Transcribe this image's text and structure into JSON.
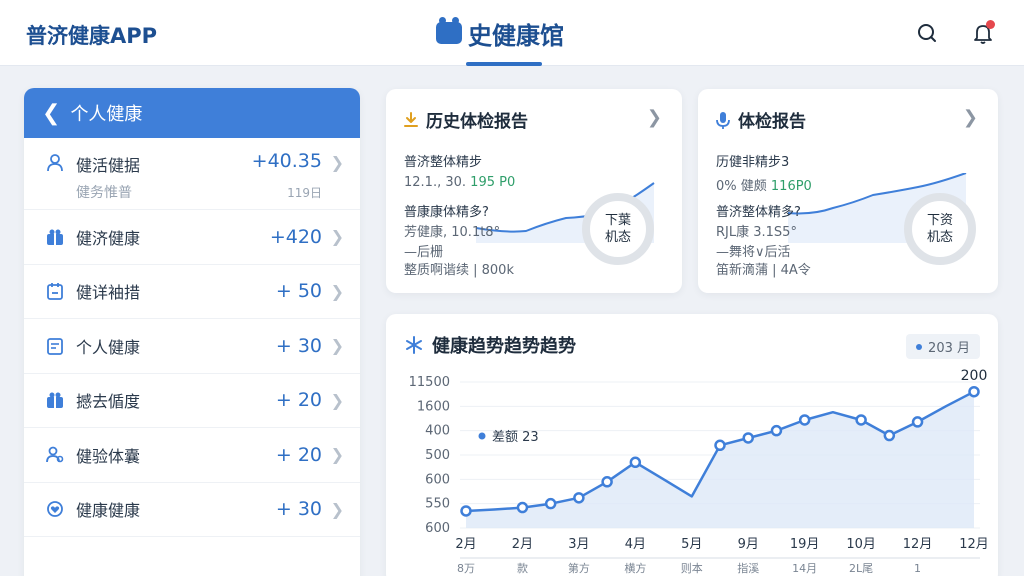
{
  "header": {
    "brand": "普济健康APP",
    "title": "史健康馆",
    "title_icon": "badge-icon"
  },
  "sidebar": {
    "title": "个人健康",
    "items": [
      {
        "label": "健活健据",
        "sub": "健务惟普",
        "sub_right": "119日",
        "value": "+40.35",
        "icon": "user-icon"
      },
      {
        "label": "健济健康",
        "value": "+420",
        "icon": "gift-icon"
      },
      {
        "label": "健详袖措",
        "value": "+ 50",
        "icon": "calendar-icon"
      },
      {
        "label": "个人健康",
        "value": "+ 30",
        "icon": "document-icon"
      },
      {
        "label": "撼去偱度",
        "value": "+ 20",
        "icon": "gift-icon"
      },
      {
        "label": "健验体囊",
        "value": "+ 20",
        "icon": "people-icon"
      },
      {
        "label": "健康健康",
        "value": "+ 30",
        "icon": "heart-icon"
      }
    ]
  },
  "card_history": {
    "title": "历史体检报告",
    "line1": "普济整体精步",
    "line2_a": "12.1., 30.",
    "line2_b": "195 P0",
    "line3": "普康康体精多?",
    "line4": "芳健康, 10.1t8°",
    "line5": "—后栅",
    "line6": "整质啊谐续 | 800k",
    "ring_top": "下葉",
    "ring_bottom": "机态"
  },
  "card_report": {
    "title": "体检报告",
    "line1": "历健非精步3",
    "line2_a": "0% 健颇",
    "line2_b": "116P0",
    "line3": "普济整体精多?",
    "line4": "RJL康 3.1S5°",
    "line5": "—舞将∨后活",
    "line6": "笛新滴蒲 | 4A令",
    "ring_top": "下资",
    "ring_bottom": "机态"
  },
  "trend": {
    "title": "健康趋势趋势趋势",
    "badge": "203 月",
    "legend": "差额 23",
    "peak_label": "200"
  },
  "chart_data": {
    "type": "line",
    "title": "健康趋势趋势趋势",
    "y_tick_labels": [
      "11500",
      "1600",
      "400",
      "500",
      "600",
      "550",
      "600"
    ],
    "categories": [
      "2月",
      "2月",
      "3月",
      "4月",
      "5月",
      "9月",
      "19月",
      "10月",
      "12月",
      "12月"
    ],
    "sub_labels": [
      "8万",
      "款",
      "第方",
      "横方",
      "则本",
      "指溪",
      "14月",
      "2L尾",
      "1"
    ],
    "series": [
      {
        "name": "差额 23",
        "x": [
          0,
          0.5,
          1,
          1.5,
          2,
          2.5,
          3,
          3.5,
          4,
          4.5,
          5,
          5.5,
          6,
          6.5,
          7,
          7.5,
          8,
          8.5,
          9
        ],
        "values": [
          605,
          602,
          598,
          590,
          578,
          545,
          505,
          540,
          575,
          470,
          455,
          440,
          418,
          402,
          418,
          450,
          422,
          390,
          360
        ]
      }
    ],
    "point_values": [
      605,
      598,
      590,
      578,
      545,
      505,
      470,
      455,
      440,
      418,
      402,
      450,
      422,
      360
    ],
    "grid": true,
    "accent": "#3f7fd9"
  }
}
